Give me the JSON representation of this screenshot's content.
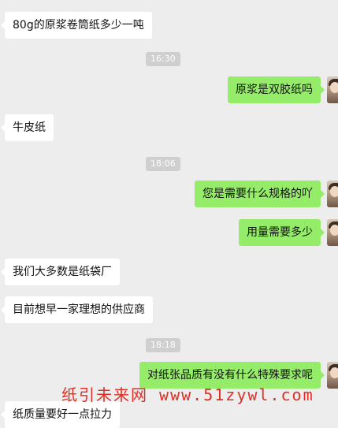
{
  "timestamps": [
    "16:30",
    "18:06",
    "18:18"
  ],
  "messages": [
    {
      "side": "in",
      "text": "80g的原浆卷筒纸多少一吨"
    },
    {
      "side": "out",
      "text": "原浆是双胶纸吗"
    },
    {
      "side": "in",
      "text": "牛皮纸"
    },
    {
      "side": "out",
      "text": "您是需要什么规格的吖"
    },
    {
      "side": "out",
      "text": "用量需要多少"
    },
    {
      "side": "in",
      "text": "我们大多数是纸袋厂"
    },
    {
      "side": "in",
      "text": "目前想早一家理想的供应商"
    },
    {
      "side": "out",
      "text": "对纸张品质有没有什么特殊要求呢"
    },
    {
      "side": "in",
      "text": "纸质量要好一点拉力"
    }
  ],
  "watermark": "纸引未来网 www.51zywl.com"
}
